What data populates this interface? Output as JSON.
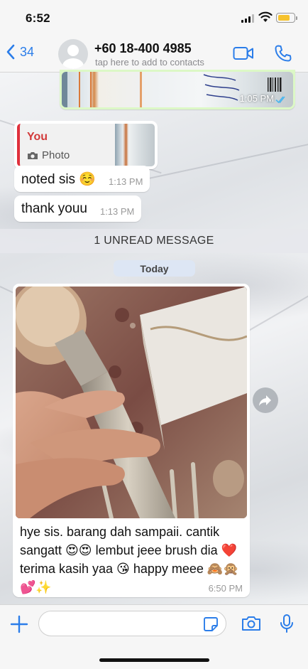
{
  "status_bar": {
    "time": "6:52",
    "battery_color": "#f6c22d"
  },
  "header": {
    "back_count": "34",
    "contact_name": "+60 18-400 4985",
    "contact_subtitle": "tap here to add to contacts",
    "accent_color": "#2b7de9",
    "icons": [
      "chevron-left-icon",
      "video-call-icon",
      "phone-call-icon"
    ]
  },
  "messages": {
    "outgoing_photo": {
      "time": "1:05 PM",
      "status": "read"
    },
    "reply": {
      "author": "You",
      "type_label": "Photo"
    },
    "noted": {
      "text": "noted sis ☺️",
      "time": "1:13 PM"
    },
    "thank": {
      "text": "thank youu",
      "time": "1:13 PM"
    },
    "unread_banner": "1 UNREAD MESSAGE",
    "date_chip": "Today",
    "incoming_photo": {
      "caption": "hye sis. barang dah sampaii. cantik sangatt 😍😍 lembut jeee brush dia ❤️ terima kasih yaa 😘 happy meee 🙈🙊💕✨",
      "time": "6:50 PM"
    }
  },
  "composer": {
    "placeholder": ""
  }
}
